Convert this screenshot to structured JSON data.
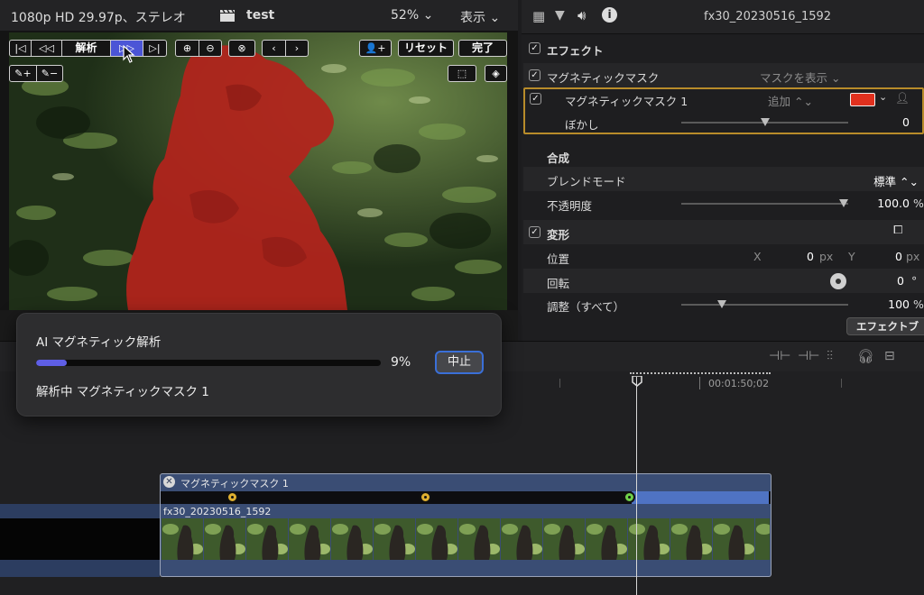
{
  "viewer": {
    "format": "1080p HD 29.97p、ステレオ",
    "project": "test",
    "zoom": "52% ⌄",
    "view_menu": "表示 ⌄",
    "toolbar": {
      "analyze": "解析",
      "reset": "リセット",
      "done": "完了"
    }
  },
  "inspector": {
    "clip_name": "fx30_20230516_1592",
    "effects_heading": "エフェクト",
    "magnetic_mask": {
      "label": "マグネティックマスク",
      "show_mask": "マスクを表示 ⌄",
      "item_label": "マグネティックマスク 1",
      "add_mode": "追加 ⌃⌄",
      "blur_label": "ぼかし",
      "blur_value": "0",
      "blur_level": 0.5,
      "color": "#e0301e"
    },
    "composite": {
      "heading": "合成",
      "blend_mode_label": "ブレンドモード",
      "blend_mode_value": "標準 ⌃⌄",
      "opacity_label": "不透明度",
      "opacity_value": "100.0",
      "opacity_unit": "%"
    },
    "transform": {
      "heading": "変形",
      "position_label": "位置",
      "x_label": "X",
      "x_value": "0",
      "x_unit": "px",
      "y_label": "Y",
      "y_value": "0",
      "y_unit": "px",
      "rotation_label": "回転",
      "rotation_value": "0",
      "rotation_unit": "°",
      "scale_label": "調整（すべて）",
      "scale_value": "100",
      "scale_unit": "%"
    },
    "effects_browser_button": "エフェクトブ"
  },
  "timeline": {
    "timecode": "00:01:50;02",
    "connected_clip": "マグネティックマスク 1",
    "main_clip": "fx30_20230516_1592"
  },
  "dialog": {
    "title": "AI マグネティック解析",
    "progress": 9,
    "percent_label": "9%",
    "stop_button": "中止",
    "status": "解析中 マグネティックマスク 1"
  },
  "colors": {
    "accent": "#4b55d6",
    "mask_highlight": "#b88c2a",
    "progress_fill": "#5f5fe6",
    "keyframe": "#e0b030",
    "clip_blue": "#3a4d74"
  }
}
